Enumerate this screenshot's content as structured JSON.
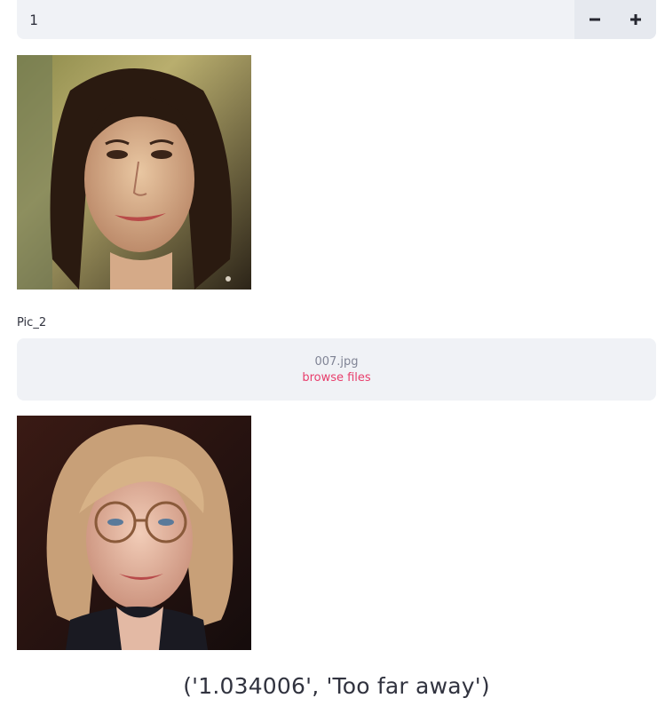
{
  "number_input": {
    "value": "1",
    "decrement_icon": "minus-icon",
    "increment_icon": "plus-icon"
  },
  "images": [
    {
      "name": "portrait-dark-hair"
    },
    {
      "name": "portrait-blonde-glasses"
    }
  ],
  "uploader": {
    "label": "Pic_2",
    "file_name": "007.jpg",
    "browse_label": "browse files"
  },
  "result_text": "('1.034006', 'Too far away')",
  "colors": {
    "panel_bg": "#f0f2f6",
    "stepper_bg": "#e6e9ef",
    "accent": "#e83e6c",
    "text": "#31333f",
    "muted": "#808495"
  }
}
